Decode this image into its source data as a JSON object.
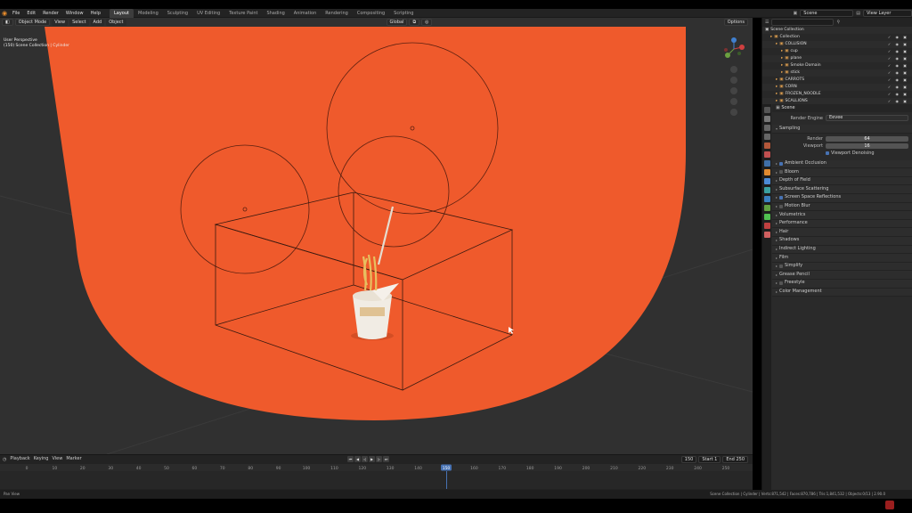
{
  "menu": [
    "File",
    "Edit",
    "Render",
    "Window",
    "Help"
  ],
  "workspaces": [
    "Layout",
    "Modeling",
    "Sculpting",
    "UV Editing",
    "Texture Paint",
    "Shading",
    "Animation",
    "Rendering",
    "Compositing",
    "Scripting"
  ],
  "active_workspace": "Layout",
  "scene_field": "Scene",
  "view_layer_field": "View Layer",
  "viewport": {
    "mode": "Object Mode",
    "menus": [
      "View",
      "Select",
      "Add",
      "Object"
    ],
    "transform": "Global",
    "options": "Options",
    "info_line1": "User Perspective",
    "info_line2": "(150) Scene Collection | Cylinder"
  },
  "timeline": {
    "menus": [
      "Playback",
      "Keying",
      "View",
      "Marker"
    ],
    "current_frame": "150",
    "start_label": "Start",
    "start": "1",
    "end_label": "End",
    "end": "250",
    "ruler": [
      "0",
      "10",
      "20",
      "30",
      "40",
      "50",
      "60",
      "70",
      "80",
      "90",
      "100",
      "110",
      "120",
      "130",
      "140",
      "150",
      "160",
      "170",
      "180",
      "190",
      "200",
      "210",
      "220",
      "230",
      "240",
      "250"
    ]
  },
  "status": {
    "left": "Pan View",
    "right": "Scene Collection | Cylinder | Verts:871,542 | Faces:870,786 | Tris:1,841,532 | Objects:0/13 | 2.90.0"
  },
  "outliner": {
    "title": "Scene Collection",
    "rows": [
      {
        "label": "Collection",
        "indent": 1
      },
      {
        "label": "COLLISION",
        "indent": 2
      },
      {
        "label": "cup",
        "indent": 3
      },
      {
        "label": "plane",
        "indent": 3
      },
      {
        "label": "Smoke Domain",
        "indent": 3
      },
      {
        "label": "stick",
        "indent": 3
      },
      {
        "label": "CARROTS",
        "indent": 2
      },
      {
        "label": "CORN",
        "indent": 2
      },
      {
        "label": "FROZEN_NOODLE",
        "indent": 2
      },
      {
        "label": "SCALLIONS",
        "indent": 2
      }
    ]
  },
  "properties": {
    "header": "Scene",
    "render_engine_label": "Render Engine",
    "render_engine": "Eevee",
    "sampling": "Sampling",
    "render_label": "Render",
    "render_samples": "64",
    "viewport_label": "Viewport",
    "viewport_samples": "16",
    "viewport_denoising": "Viewport Denoising",
    "panels": [
      {
        "label": "Ambient Occlusion",
        "check": true
      },
      {
        "label": "Bloom",
        "check": false
      },
      {
        "label": "Depth of Field",
        "check": null
      },
      {
        "label": "Subsurface Scattering",
        "check": null
      },
      {
        "label": "Screen Space Reflections",
        "check": true
      },
      {
        "label": "Motion Blur",
        "check": false
      },
      {
        "label": "Volumetrics",
        "check": null
      },
      {
        "label": "Performance",
        "check": null
      },
      {
        "label": "Hair",
        "check": null
      },
      {
        "label": "Shadows",
        "check": null
      },
      {
        "label": "Indirect Lighting",
        "check": null
      },
      {
        "label": "Film",
        "check": null
      },
      {
        "label": "Simplify",
        "check": false
      },
      {
        "label": "Grease Pencil",
        "check": null
      },
      {
        "label": "Freestyle",
        "check": false
      },
      {
        "label": "Color Management",
        "check": null
      }
    ]
  },
  "colors": {
    "backdrop": "#ef5a2c",
    "accent": "#4772b3",
    "grid": "#313131"
  }
}
